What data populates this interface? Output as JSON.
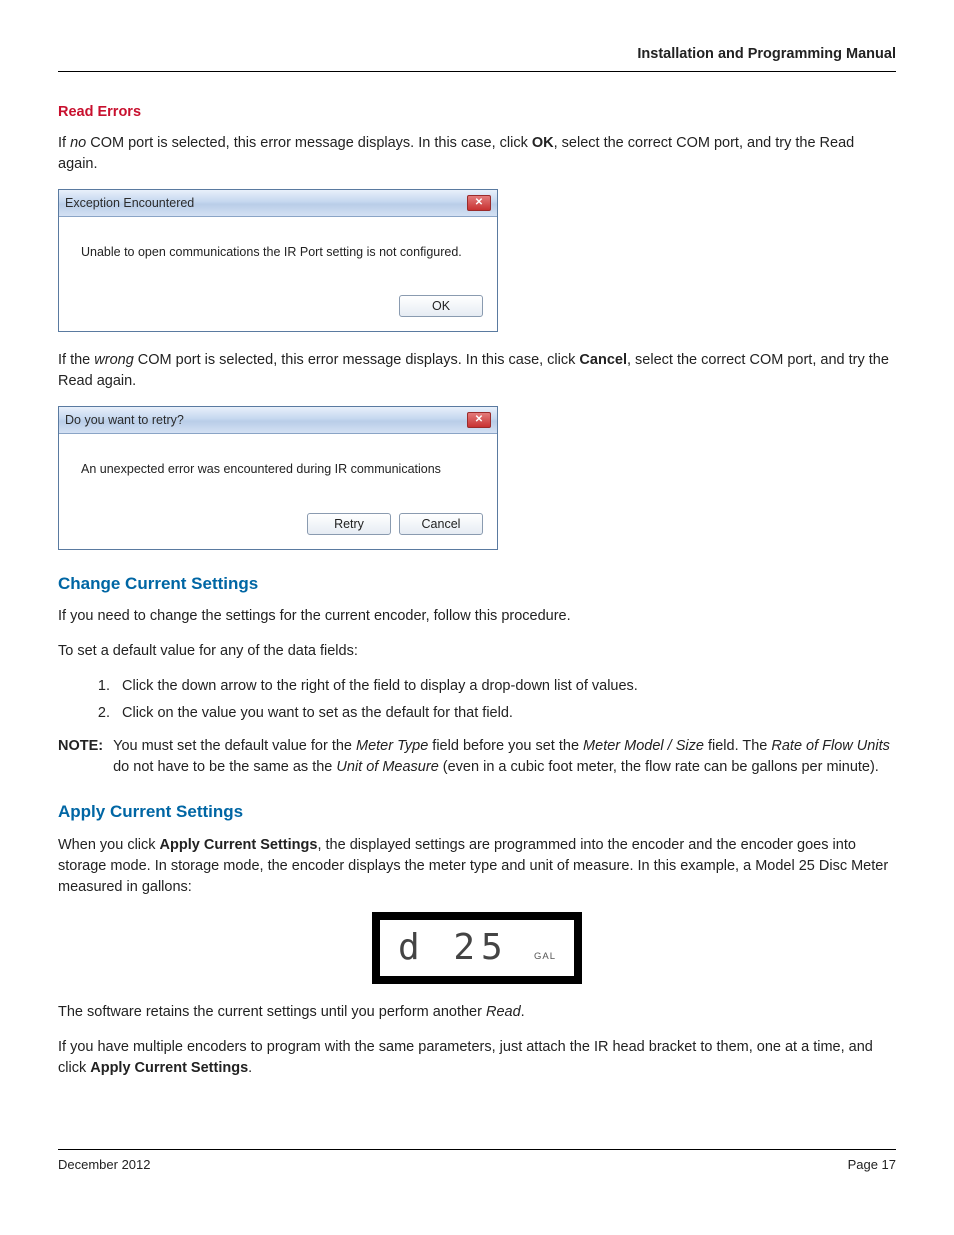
{
  "header": {
    "title": "Installation and Programming Manual"
  },
  "sec_read_errors": {
    "heading": "Read Errors",
    "p1_a": "If ",
    "p1_no": "no",
    "p1_b": " COM port is selected, this error message displays. In this case, click ",
    "p1_ok": "OK",
    "p1_c": ", select the correct COM port, and try the Read again.",
    "p2_a": "If the ",
    "p2_wrong": "wrong",
    "p2_b": " COM port is selected, this error message displays. In this case, click ",
    "p2_cancel": "Cancel",
    "p2_c": ", select the correct COM port, and try the Read again."
  },
  "dialog1": {
    "title": "Exception Encountered",
    "body": "Unable to open communications the IR Port setting is not configured.",
    "ok": "OK",
    "close_glyph": "✕"
  },
  "dialog2": {
    "title": "Do you want to retry?",
    "body": "An unexpected error was encountered during IR communications",
    "retry": "Retry",
    "cancel": "Cancel",
    "close_glyph": "✕"
  },
  "sec_change": {
    "heading": "Change Current Settings",
    "p1": "If you need to change the settings for the current encoder, follow this procedure.",
    "p2": "To set a default value for any of the data fields:",
    "li1": "Click the down arrow to the right of the field to display a drop-down list of values.",
    "li2": "Click on the value you want to set as the default for that field."
  },
  "note": {
    "label": "NOTE:",
    "t1": "You must set the default value for the ",
    "i1": "Meter Type",
    "t2": " field before you set the ",
    "i2": "Meter Model / Size",
    "t3": " field. The ",
    "i3": "Rate of Flow Units",
    "t4": " do not have to be the same as the ",
    "i4": "Unit of Measure",
    "t5": " (even in a cubic foot meter, the flow rate can be gallons per minute)."
  },
  "sec_apply": {
    "heading": "Apply Current Settings",
    "p1_a": "When you click ",
    "p1_b": "Apply Current Settings",
    "p1_c": ", the displayed settings are programmed into the encoder and the encoder goes into storage mode. In storage mode, the encoder displays the meter type and unit of measure. In this example, a Model 25 Disc Meter measured in gallons:",
    "p2_a": "The software retains the current settings until you perform another ",
    "p2_read": "Read",
    "p2_b": ".",
    "p3_a": "If you have multiple encoders to program with the same parameters, just attach the IR head bracket to them, one at a time, and click ",
    "p3_b": "Apply Current Settings",
    "p3_c": "."
  },
  "lcd": {
    "reading": "d  25",
    "unit": "GAL"
  },
  "footer": {
    "left": "December 2012",
    "right": "Page 17"
  }
}
